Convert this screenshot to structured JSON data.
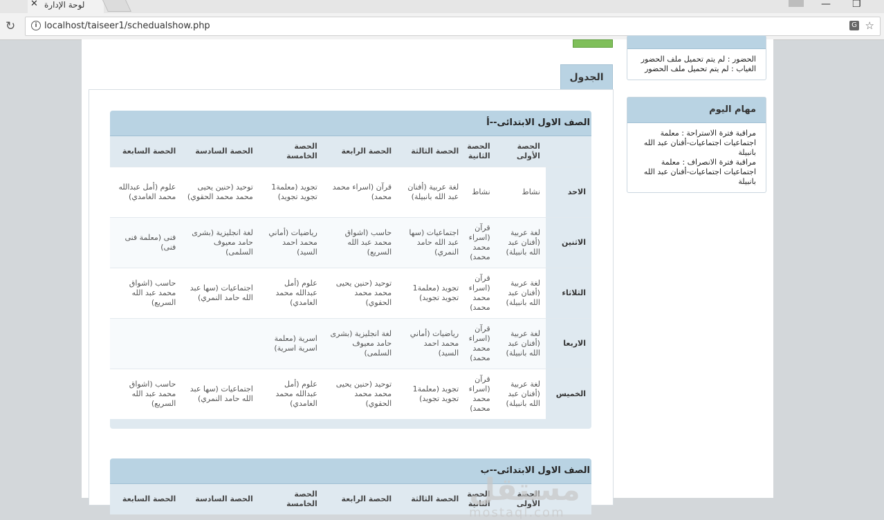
{
  "browser": {
    "tab_title": "لوحة الإدارة",
    "tab_close": "✕",
    "url": "localhost/taiseer1/schedualshow.php"
  },
  "main": {
    "tab_label": "الجدول",
    "columns": [
      "",
      "الحصة الأولى",
      "الحصة الثانية",
      "الحصة الثالثة",
      "الحصة الرابعة",
      "الحصة الخامسة",
      "الحصة السادسة",
      "الحصة السابعة"
    ],
    "schedules": [
      {
        "title": "الصف الاول الابتدائى--أ",
        "rows": [
          {
            "day": "الاحد",
            "cells": [
              "نشاط",
              "نشاط",
              "لغة عربية (أفنان عبد الله بانبيلة)",
              "قرآن (اسراء محمد محمد)",
              "تجويد (معلمة1 تجويد تجويد)",
              "توحيد (حنين يحيى محمد محمد الحقوي)",
              "علوم (أمل عبدالله محمد الغامدي)"
            ]
          },
          {
            "day": "الاثنين",
            "cells": [
              "لغة عربية (أفنان عبد الله بانبيلة)",
              "قرآن (اسراء محمد محمد)",
              "اجتماعيات (سها عبد الله حامد النمري)",
              "حاسب (اشواق محمد عبد الله السريع)",
              "رياضيات (أماني محمد احمد السيد)",
              "لغة انجليزية (بشرى حامد معيوف السلمى)",
              "فنى (معلمة فنى فنى)"
            ]
          },
          {
            "day": "الثلاثاء",
            "cells": [
              "لغة عربية (أفنان عبد الله بانبيلة)",
              "قرآن (اسراء محمد محمد)",
              "تجويد (معلمة1 تجويد تجويد)",
              "توحيد (حنين يحيى محمد محمد الحقوي)",
              "علوم (أمل عبدالله محمد الغامدي)",
              "اجتماعيات (سها عبد الله حامد النمري)",
              "حاسب (اشواق محمد عبد الله السريع)"
            ]
          },
          {
            "day": "الاربعا",
            "cells": [
              "لغة عربية (أفنان عبد الله بانبيلة)",
              "قرآن (اسراء محمد محمد)",
              "رياضيات (أماني محمد احمد السيد)",
              "لغة انجليزية (بشرى حامد معيوف السلمى)",
              "اسرية (معلمة اسرية اسرية)",
              "",
              ""
            ]
          },
          {
            "day": "الخميس",
            "cells": [
              "لغة عربية (أفنان عبد الله بانبيلة)",
              "قرآن (اسراء محمد محمد)",
              "تجويد (معلمة1 تجويد تجويد)",
              "توحيد (حنين يحيى محمد محمد الحقوي)",
              "علوم (أمل عبدالله محمد الغامدي)",
              "اجتماعيات (سها عبد الله حامد النمري)",
              "حاسب (اشواق محمد عبد الله السريع)"
            ]
          }
        ]
      },
      {
        "title": "الصف الاول الابتدائى--ب",
        "rows": []
      }
    ]
  },
  "sidebar": {
    "attendance_lines": [
      "الحضور : لم يتم تحميل ملف الحضور",
      "الغياب : لم يتم تحميل ملف الحضور"
    ],
    "tasks_title": "مهام اليوم",
    "tasks_lines": [
      "مراقبة فترة الاستراحة : معلمة اجتماعيات اجتماعيات-أفنان عبد الله بانبيلة",
      "مراقبة فترة الانصراف : معلمة اجتماعيات اجتماعيات-أفنان عبد الله بانبيلة"
    ]
  },
  "watermark": {
    "line1": "مستقل",
    "line2": "mostaql.com"
  },
  "colors": {
    "header_blue": "#b9d3e3",
    "panel_bg": "#edf3f7",
    "page_bg": "#d3d7da"
  }
}
